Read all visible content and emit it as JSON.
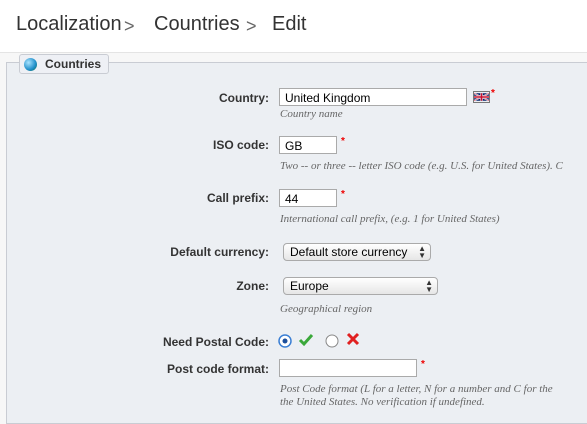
{
  "breadcrumb": {
    "items": [
      "Localization",
      "Countries",
      "Edit"
    ],
    "separator": ">"
  },
  "panel": {
    "title": "Countries"
  },
  "form": {
    "country": {
      "label": "Country:",
      "value": "United Kingdom",
      "help": "Country name",
      "flag_icon": "uk-flag-icon"
    },
    "iso": {
      "label": "ISO code:",
      "value": "GB",
      "help": "Two -- or three -- letter ISO code (e.g. U.S. for United States). C"
    },
    "call_prefix": {
      "label": "Call prefix:",
      "value": "44",
      "help": "International call prefix, (e.g. 1 for United States)"
    },
    "currency": {
      "label": "Default currency:",
      "value": "Default store currency"
    },
    "zone": {
      "label": "Zone:",
      "value": "Europe",
      "help": "Geographical region"
    },
    "postal": {
      "label": "Need Postal Code:",
      "selected": "yes",
      "yes_icon": "green-check-icon",
      "no_icon": "red-x-icon"
    },
    "post_code_format": {
      "label": "Post code format:",
      "value": "",
      "help_line1": "Post Code format (L for a letter, N for a number and C for the",
      "help_line2": "the United States. No verification if undefined."
    }
  },
  "required_mark": "*",
  "colors": {
    "required": "#e00000",
    "check": "#3aa83a",
    "cross": "#e02020"
  }
}
